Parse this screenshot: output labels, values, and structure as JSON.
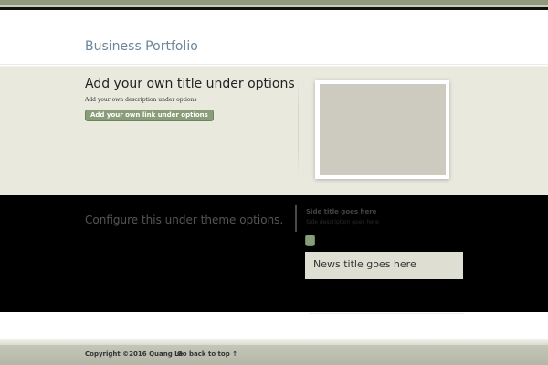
{
  "header": {
    "site_title": "Business Portfolio"
  },
  "hero": {
    "title": "Add your own title under options",
    "description": "Add your own description under options",
    "link_label": "Add your own link under options"
  },
  "dark_band": {
    "configure_text": "Configure this under theme options.",
    "side_title": "Side title goes here",
    "side_description": "Side description goes here",
    "news_title": "News title goes here"
  },
  "footer": {
    "copyright": "Copyright ©2016 Quang Le",
    "back_to_top": "Go back to top ↑"
  },
  "colors": {
    "accent_green": "#8a9d79",
    "title_blue": "#6a869c",
    "hero_bg": "#e9e9de",
    "dark_band_bg": "#000000",
    "news_box_bg": "#deded2",
    "footer_bg": "#bcbeb0"
  }
}
